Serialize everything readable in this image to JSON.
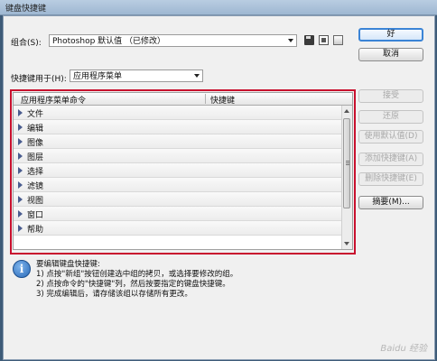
{
  "window": {
    "title": "键盘快捷键"
  },
  "set": {
    "label": "组合(S):",
    "value": "Photoshop 默认值 （已修改）"
  },
  "shortcuts_for": {
    "label": "快捷键用于(H):",
    "value": "应用程序菜单"
  },
  "table": {
    "col_command": "应用程序菜单命令",
    "col_shortcut": "快捷键",
    "rows": [
      "文件",
      "编辑",
      "图像",
      "图层",
      "选择",
      "滤镜",
      "视图",
      "窗口",
      "帮助"
    ]
  },
  "buttons": {
    "ok": "好",
    "cancel": "取消",
    "accept": "接受",
    "undo": "还原",
    "use_default": "使用默认值(D)",
    "add_shortcut": "添加快捷键(A)",
    "delete_shortcut": "删除快捷键(E)",
    "summarize": "摘要(M)..."
  },
  "info": {
    "heading": "要编辑键盘快捷键:",
    "line1": "1) 点按\"新组\"按钮创建选中组的拷贝，或选择要修改的组。",
    "line2": "2) 点按命令的\"快捷键\"列，然后按要指定的键盘快捷键。",
    "line3": "3) 完成编辑后，请存储该组以存储所有更改。"
  },
  "watermark": "Baidu 经验"
}
